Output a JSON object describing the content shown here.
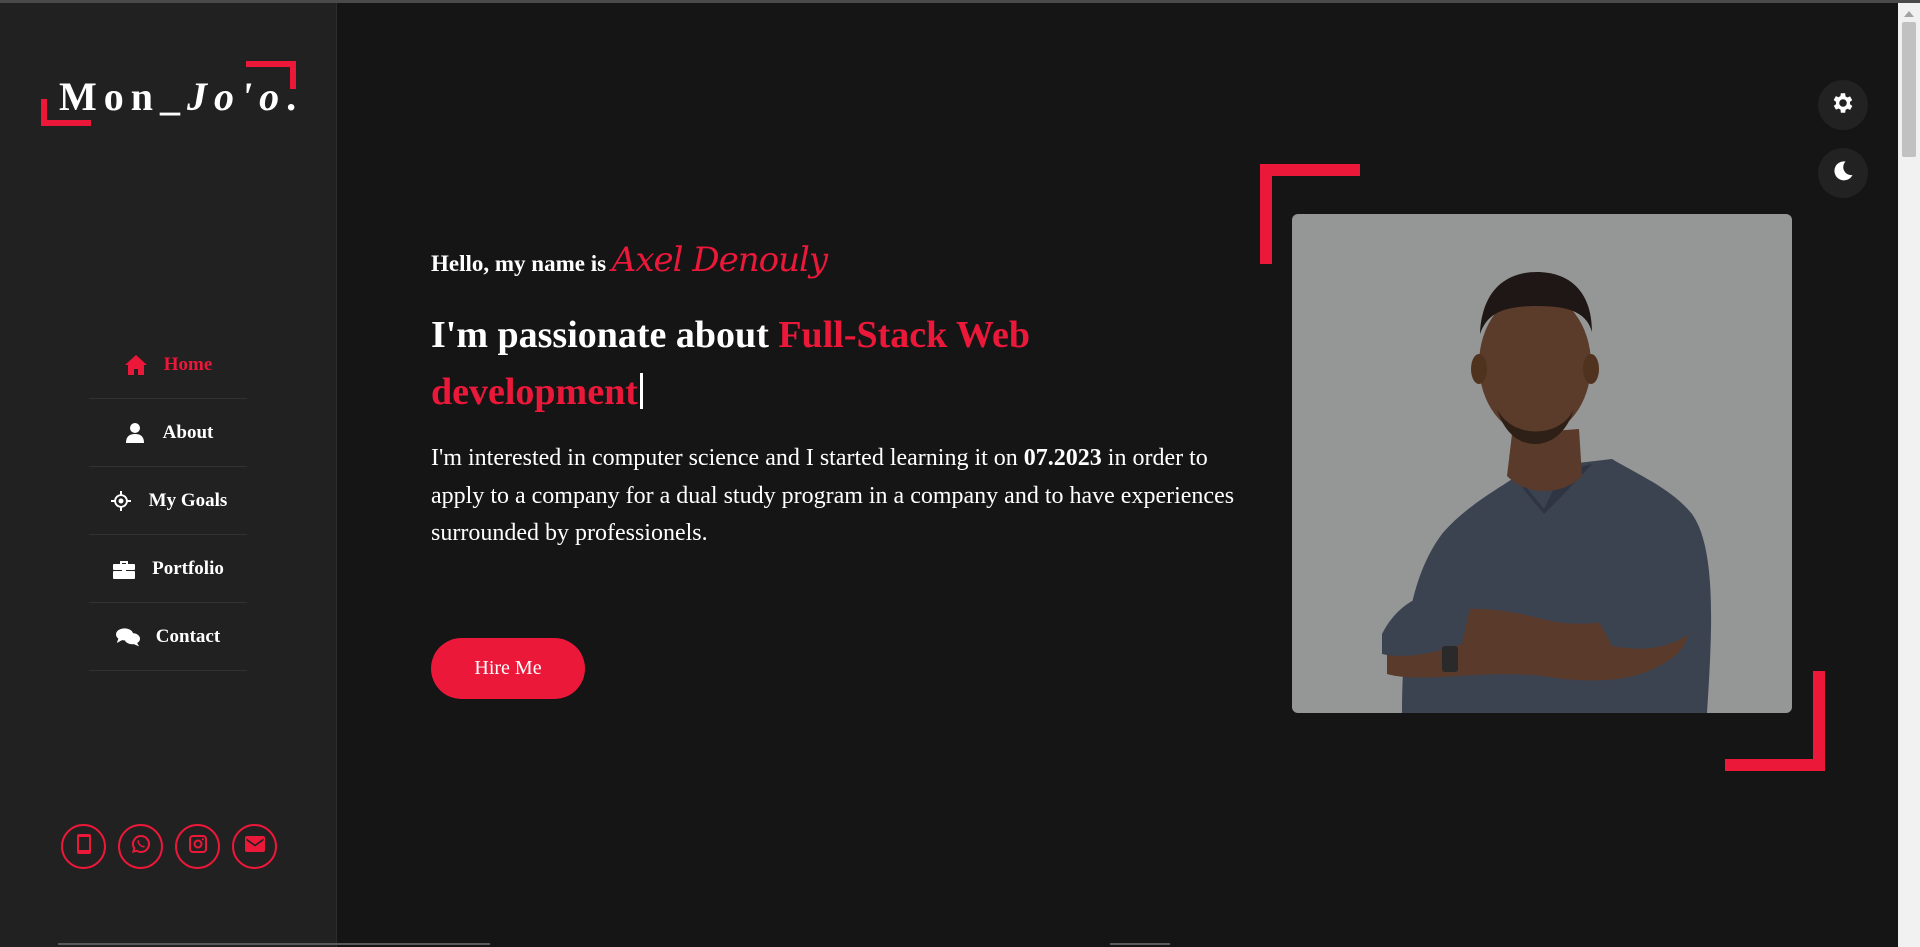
{
  "logo": {
    "part1": "Mon_",
    "part2": "Jo'o",
    "dot": "."
  },
  "nav": {
    "items": [
      {
        "label": "Home",
        "icon": "home-icon",
        "active": true
      },
      {
        "label": "About",
        "icon": "user-icon",
        "active": false
      },
      {
        "label": "My Goals",
        "icon": "target-icon",
        "active": false
      },
      {
        "label": "Portfolio",
        "icon": "briefcase-icon",
        "active": false
      },
      {
        "label": "Contact",
        "icon": "chat-icon",
        "active": false
      }
    ]
  },
  "socials": [
    "phone-icon",
    "whatsapp-icon",
    "instagram-icon",
    "mail-icon"
  ],
  "hero": {
    "greeting": "Hello, my name is ",
    "name": "Axel Denouly",
    "headline_prefix": "I'm passionate about ",
    "headline_highlight": "Full-Stack Web development",
    "description_before": "I'm interested in computer science and I started learning it on ",
    "description_date": "07.2023",
    "description_after": " in order to apply to a company for a dual study program in a company and to have experiences surrounded by professionels.",
    "hire_button": "Hire Me"
  },
  "tools": [
    "settings-gear-icon",
    "dark-mode-moon-icon"
  ],
  "colors": {
    "accent": "#ec1839",
    "background": "#151516",
    "sidebar": "#212121"
  }
}
